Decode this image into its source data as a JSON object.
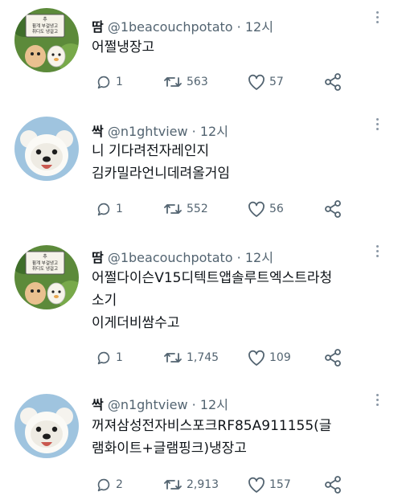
{
  "tweets": [
    {
      "name": "땀",
      "handle": "@1beacouchpotato",
      "separator": "·",
      "time": "12시",
      "avatar": "sign-character-avatar",
      "lines": [
        "어쩔냉장고"
      ],
      "replies": "1",
      "retweets": "563",
      "likes": "57"
    },
    {
      "name": "싹",
      "handle": "@n1ghtview",
      "separator": "·",
      "time": "12시",
      "avatar": "white-dog-avatar",
      "lines": [
        "니 기다려전자레인지",
        "김카밀라언니데려올거임"
      ],
      "replies": "1",
      "retweets": "552",
      "likes": "56"
    },
    {
      "name": "땀",
      "handle": "@1beacouchpotato",
      "separator": "·",
      "time": "12시",
      "avatar": "sign-character-avatar",
      "lines": [
        "어쩔다이슨V15디텍트앱솔루트엑스트라청",
        "소기",
        "이게더비쌈수고"
      ],
      "replies": "1",
      "retweets": "1,745",
      "likes": "109"
    },
    {
      "name": "싹",
      "handle": "@n1ghtview",
      "separator": "·",
      "time": "12시",
      "avatar": "white-dog-avatar",
      "lines": [
        "꺼져삼성전자비스포크RF85A911155(글",
        "램화이트+글램핑크)냉장고"
      ],
      "replies": "2",
      "retweets": "2,913",
      "likes": "157"
    }
  ],
  "avatar_sign_text": [
    "추",
    "휠걔 부걸냉고",
    "취디도 냉걸고"
  ],
  "colors": {
    "text": "#0f1419",
    "secondary": "#536471",
    "background": "#ffffff"
  },
  "icons": {
    "reply": "reply-icon",
    "retweet": "retweet-icon",
    "like": "heart-icon",
    "share": "share-icon",
    "more": "more-icon"
  }
}
